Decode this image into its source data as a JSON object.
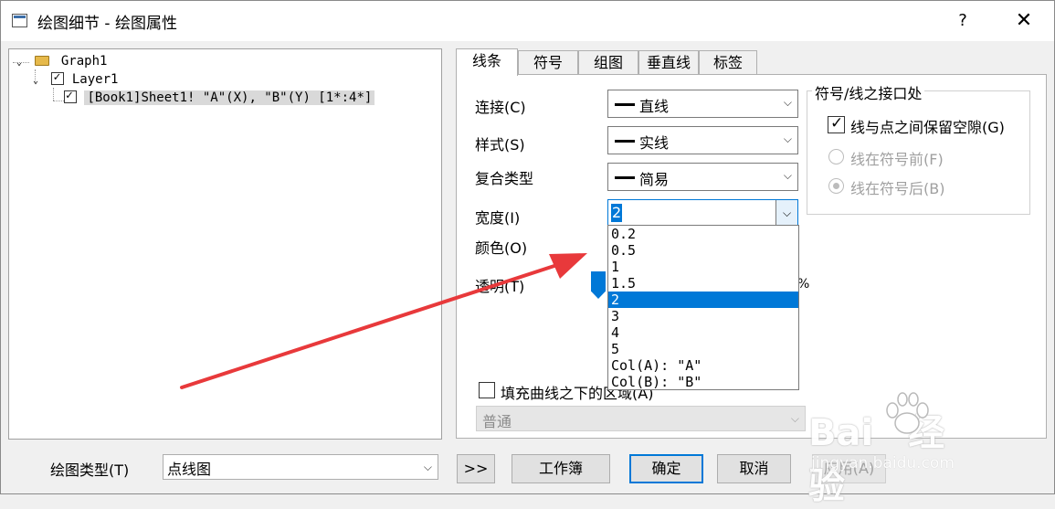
{
  "window": {
    "title": "绘图细节 - 绘图属性",
    "help_label": "?",
    "close_label": "✕"
  },
  "tree": {
    "root": "Graph1",
    "layer": "Layer1",
    "plot": "[Book1]Sheet1! \"A\"(X), \"B\"(Y) [1*:4*]"
  },
  "tabs": [
    {
      "label": "线条",
      "active": true
    },
    {
      "label": "符号",
      "active": false
    },
    {
      "label": "组图",
      "active": false
    },
    {
      "label": "垂直线",
      "active": false
    },
    {
      "label": "标签",
      "active": false
    }
  ],
  "line_tab": {
    "connect_label": "连接(C)",
    "connect_value": "直线",
    "style_label": "样式(S)",
    "style_value": "实线",
    "compound_label": "复合类型",
    "compound_value": "简易",
    "width_label": "宽度(I)",
    "width_value": "2",
    "color_label": "颜色(O)",
    "transparency_label": "透明(T)",
    "transparency_suffix": "%",
    "fill_label": "填充曲线之下的区域(A)",
    "fill_checked": false,
    "fill_mode_value": "普通"
  },
  "width_dropdown": {
    "options": [
      "0.2",
      "0.5",
      "1",
      "1.5",
      "2",
      "3",
      "4",
      "5",
      "Col(A): \"A\"",
      "Col(B): \"B\""
    ],
    "selected": "2"
  },
  "gap_group": {
    "title": "符号/线之接口处",
    "gap_checkbox_label": "线与点之间保留空隙(G)",
    "gap_checked": true,
    "before_label": "线在符号前(F)",
    "after_label": "线在符号后(B)",
    "after_selected": true
  },
  "footer": {
    "plot_type_label": "绘图类型(T)",
    "plot_type_value": "点线图",
    "expand_label": ">>",
    "workbook_label": "工作簿",
    "ok_label": "确定",
    "cancel_label": "取消",
    "apply_label": "应用(A)"
  },
  "watermark": {
    "brand": "Bai",
    "brand_suffix": "经验",
    "site": "jingyan.baidu.com"
  },
  "colors": {
    "accent": "#0078d7",
    "annotation_arrow": "#e8393b"
  }
}
